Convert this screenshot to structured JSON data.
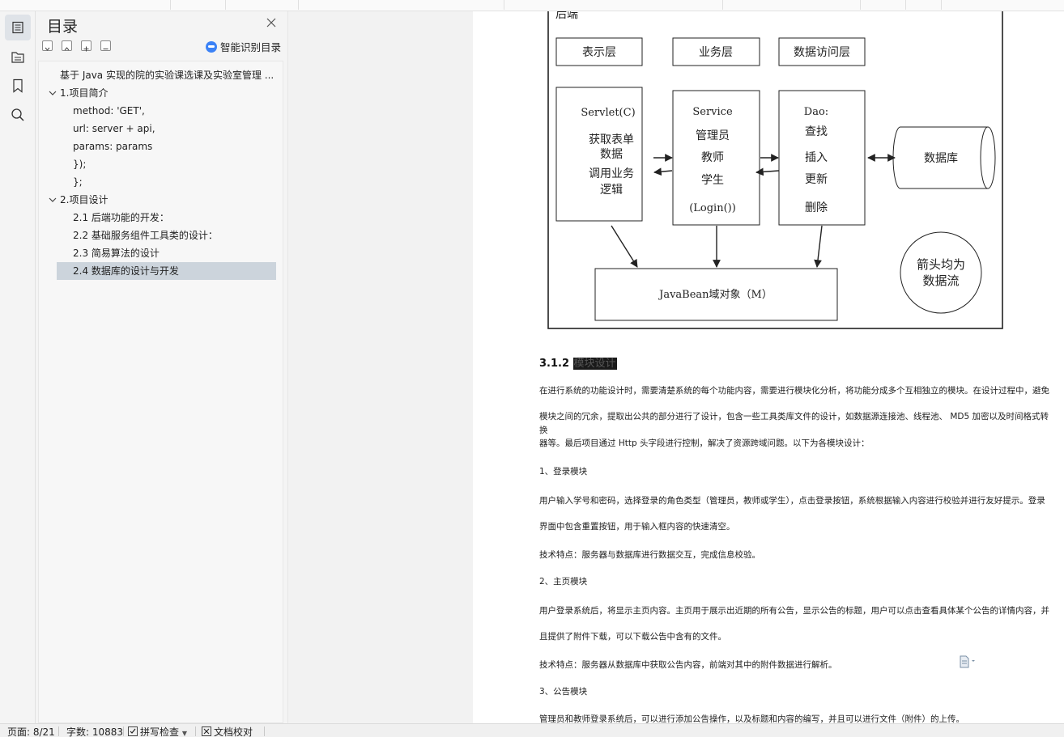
{
  "toc": {
    "title": "目录",
    "smart_label": "智能识别目录",
    "items": [
      {
        "label": "基于 Java 实现的院的实验课选课及实验室管理 ...",
        "level": 0,
        "expandable": false
      },
      {
        "label": "1.项目简介",
        "level": 0,
        "expandable": true
      },
      {
        "label": "method: 'GET',",
        "level": 1,
        "expandable": false
      },
      {
        "label": "url: server + api,",
        "level": 1,
        "expandable": false
      },
      {
        "label": "params: params",
        "level": 1,
        "expandable": false
      },
      {
        "label": "});",
        "level": 1,
        "expandable": false
      },
      {
        "label": "};",
        "level": 1,
        "expandable": false
      },
      {
        "label": "2.项目设计",
        "level": 0,
        "expandable": true
      },
      {
        "label": "2.1 后端功能的开发：",
        "level": 1,
        "expandable": false
      },
      {
        "label": "2.2 基础服务组件工具类的设计：",
        "level": 1,
        "expandable": false
      },
      {
        "label": "2.3 简易算法的设计",
        "level": 1,
        "expandable": false
      },
      {
        "label": "2.4 数据库的设计与开发",
        "level": 1,
        "expandable": false,
        "selected": true
      }
    ]
  },
  "diagram": {
    "frame_label": "后端",
    "layer_present": "表示层",
    "layer_business": "业务层",
    "layer_dao": "数据访问层",
    "servlet_title": "Servlet(C)",
    "servlet_lines": [
      "获取表单",
      "数据",
      "调用业务",
      "逻辑"
    ],
    "service_title": "Service",
    "service_lines": [
      "管理员",
      "教师",
      "学生",
      "(Login())"
    ],
    "dao_title": "Dao:",
    "dao_lines": [
      "查找",
      "插入",
      "更新",
      "删除"
    ],
    "database": "数据库",
    "javabean": "JavaBean域对象（M）",
    "note_lines": [
      "箭头均为",
      "数据流"
    ]
  },
  "doc": {
    "heading_num": "3.1.2",
    "heading_text": "模块设计",
    "paragraphs": [
      "在进行系统的功能设计时，需要清楚系统的每个功能内容，需要进行模块化分析，将功能分成多个互相独立的模块。在设计过程中，避免",
      "模块之间的冗余，提取出公共的部分进行了设计，包含一些工具类库文件的设计，如数据源连接池、线程池、 MD5 加密以及时间格式转换",
      "器等。最后项目通过 Http 头字段进行控制，解决了资源跨域问题。以下为各模块设计：",
      "1、登录模块",
      "用户输入学号和密码，选择登录的角色类型（管理员，教师或学生），点击登录按钮，系统根据输入内容进行校验并进行友好提示。登录",
      "界面中包含重置按钮，用于输入框内容的快速清空。",
      "技术特点：服务器与数据库进行数据交互，完成信息校验。",
      "2、主页模块",
      "用户登录系统后，将显示主页内容。主页用于展示出近期的所有公告，显示公告的标题，用户可以点击查看具体某个公告的详情内容，并",
      "且提供了附件下载，可以下载公告中含有的文件。",
      "技术特点：服务器从数据库中获取公告内容，前端对其中的附件数据进行解析。",
      "3、公告模块",
      "管理员和教师登录系统后，可以进行添加公告操作，以及标题和内容的编写，并且可以进行文件（附件）的上传。"
    ]
  },
  "status": {
    "page": "页面: 8/21",
    "words": "字数: 10883",
    "spell": "拼写检查",
    "proof": "文档校对"
  }
}
